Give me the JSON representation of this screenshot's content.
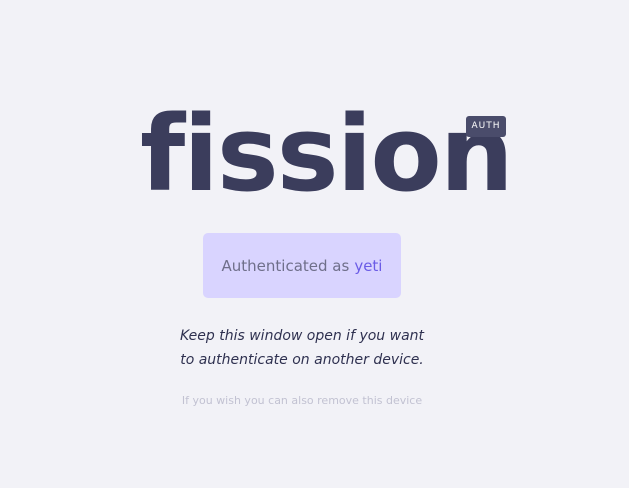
{
  "logo": {
    "wordmark": "fission",
    "badge": "AUTH"
  },
  "auth_status": {
    "prefix": "Authenticated as",
    "username": "yeti"
  },
  "message": {
    "line1": "Keep this window open if you want",
    "line2": "to authenticate on another device."
  },
  "remove_device_link": "If you wish you can also remove this device"
}
